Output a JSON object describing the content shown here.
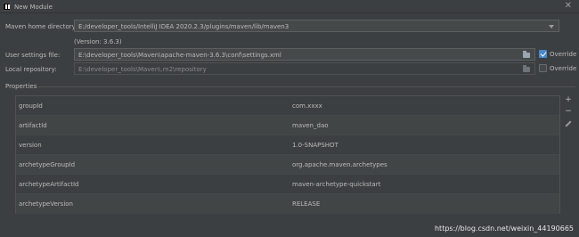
{
  "window": {
    "title": "New Module"
  },
  "maven": {
    "home_label": "Maven home directory:",
    "home_value": "E:/developer_tools/IntelliJ IDEA 2020.2.3/plugins/maven/lib/maven3",
    "version_text": "(Version: 3.6.3)",
    "settings_label": "User settings file:",
    "settings_value": "E:\\developer_tools\\Maven\\apache-maven-3.6.3\\conf\\settings.xml",
    "settings_override_label": "Override",
    "settings_override_checked": true,
    "repo_label": "Local repository:",
    "repo_value": "E:\\developer_tools\\Maven\\.m2\\repository",
    "repo_override_label": "Override",
    "repo_override_checked": false
  },
  "properties": {
    "section_label": "Properties",
    "rows": [
      {
        "key": "groupId",
        "value": "com.xxxx"
      },
      {
        "key": "artifactId",
        "value": "maven_dao"
      },
      {
        "key": "version",
        "value": "1.0-SNAPSHOT"
      },
      {
        "key": "archetypeGroupId",
        "value": "org.apache.maven.archetypes"
      },
      {
        "key": "archetypeArtifactId",
        "value": "maven-archetype-quickstart"
      },
      {
        "key": "archetypeVersion",
        "value": "RELEASE"
      }
    ],
    "toolbar": {
      "add": "+",
      "remove": "−"
    }
  },
  "watermark": "https://blog.csdn.net/weixin_44190665",
  "icons": {
    "app": "intellij-app-icon",
    "close": "close-icon",
    "folder": "folder-icon",
    "dropdown": "chevron-down-icon",
    "edit": "pencil-icon"
  },
  "colors": {
    "accent": "#4a88c7",
    "background": "#3c3f41"
  }
}
